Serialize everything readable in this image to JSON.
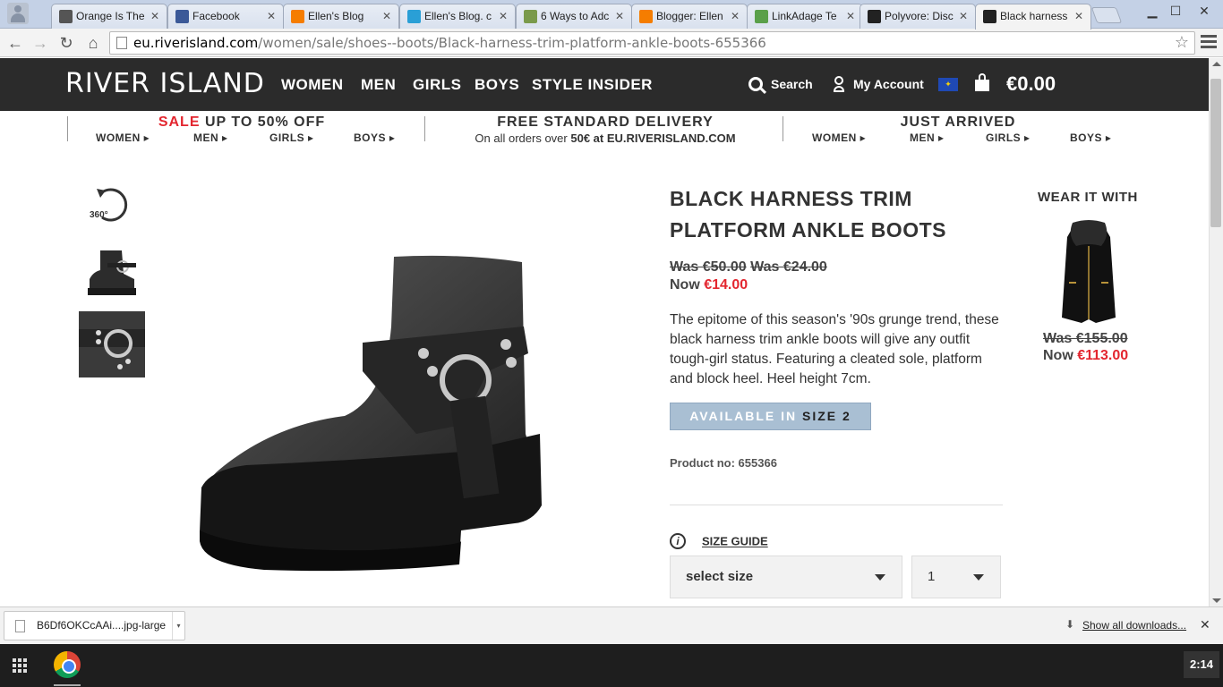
{
  "browser": {
    "tabs": [
      {
        "title": "Orange Is The",
        "icon": "keyboard-icon",
        "color": "#555555"
      },
      {
        "title": "Facebook",
        "icon": "facebook-icon",
        "color": "#3b5998"
      },
      {
        "title": "Ellen's Blog",
        "icon": "blogger-icon",
        "color": "#f57d00"
      },
      {
        "title": "Ellen's Blog. c",
        "icon": "plus-icon",
        "color": "#2a9fd6"
      },
      {
        "title": "6 Ways to Adc",
        "icon": "wikihow-icon",
        "color": "#7a9a4b"
      },
      {
        "title": "Blogger: Ellen",
        "icon": "blogger-icon",
        "color": "#f57d00"
      },
      {
        "title": "LinkAdage Te",
        "icon": "linkadage-icon",
        "color": "#5aa04a"
      },
      {
        "title": "Polyvore: Disc",
        "icon": "polyvore-icon",
        "color": "#222222"
      },
      {
        "title": "Black harness",
        "icon": "riverisland-icon",
        "color": "#222222"
      }
    ],
    "url_domain": "eu.riverisland.com",
    "url_path": "/women/sale/shoes--boots/Black-harness-trim-platform-ankle-boots-655366"
  },
  "site": {
    "logo": "RIVER ISLAND",
    "nav": [
      "WOMEN",
      "MEN",
      "GIRLS",
      "BOYS",
      "STYLE INSIDER"
    ],
    "search": "Search",
    "account": "My Account",
    "cart_total": "€0.00"
  },
  "promo": {
    "sale_word": "SALE",
    "sale_rest": " UP TO 50% OFF",
    "sale_links": [
      "WOMEN ▸",
      "MEN ▸",
      "GIRLS ▸",
      "BOYS ▸"
    ],
    "delivery_title": "FREE STANDARD DELIVERY",
    "delivery_pre": "On all orders over ",
    "delivery_amount": "50€",
    "delivery_post": " at EU.RIVERISLAND.COM",
    "arrived_title": "JUST ARRIVED",
    "arrived_links": [
      "WOMEN ▸",
      "MEN ▸",
      "GIRLS ▸",
      "BOYS ▸"
    ]
  },
  "product": {
    "title": "BLACK HARNESS TRIM PLATFORM ANKLE BOOTS",
    "was1": "Was €50.00",
    "was2": "Was €24.00",
    "now_label": "Now ",
    "now_price": "€14.00",
    "description": "The epitome of this season's '90s grunge trend, these black harness trim ankle boots will give any outfit tough-girl status. Featuring a cleated sole, platform and block heel. Heel height 7cm.",
    "available_label": "AVAILABLE IN",
    "available_size": "SIZE 2",
    "product_no": "Product no: 655366",
    "size_guide": "SIZE GUIDE",
    "size_select": "select size",
    "qty": "1",
    "view360": "360°"
  },
  "wear_it_with": {
    "heading": "WEAR IT WITH",
    "was": "Was €155.00",
    "now_label": "Now ",
    "now_price": "€113.00"
  },
  "downloads": {
    "file": "B6Df6OKCcAAi....jpg-large",
    "show_all": "Show all downloads..."
  },
  "taskbar": {
    "clock": "2:14"
  }
}
